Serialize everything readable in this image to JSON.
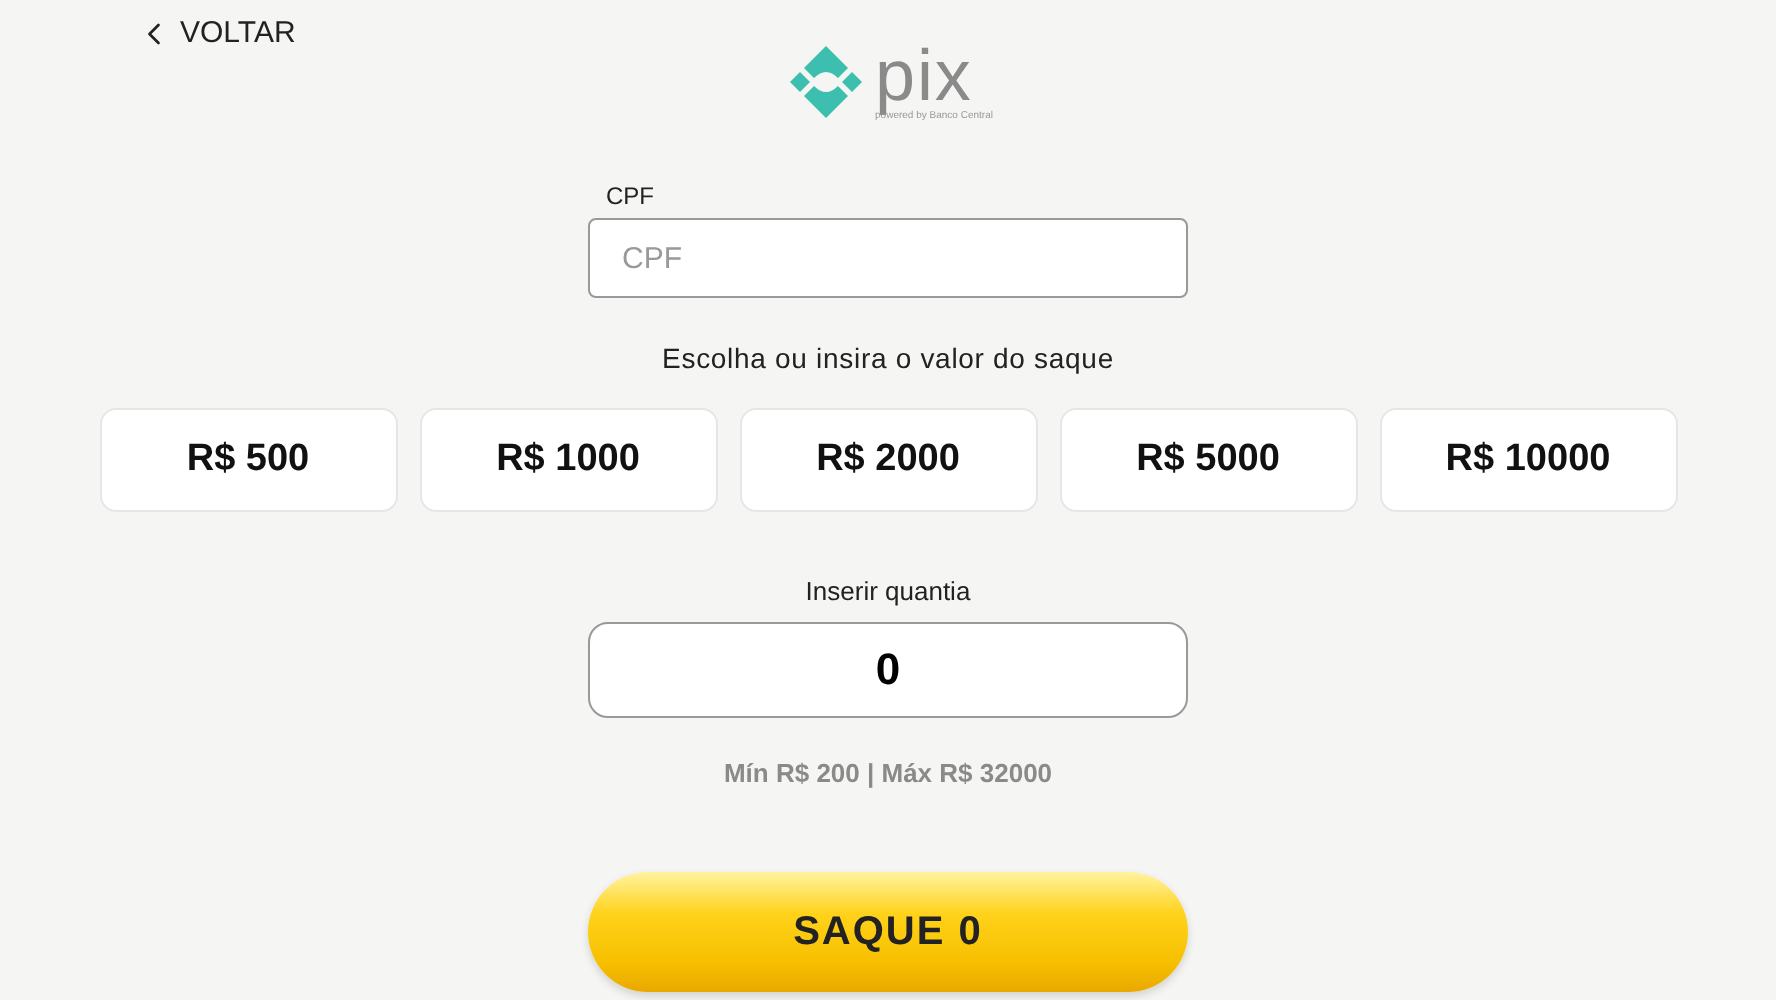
{
  "back_link": {
    "label": "VOLTAR"
  },
  "logo": {
    "wordmark": "pix",
    "tagline": "powered by Banco Central"
  },
  "cpf_field": {
    "label": "CPF",
    "placeholder": "CPF"
  },
  "amount_prompt": "Escolha ou insira o valor do saque",
  "amount_options": [
    {
      "label": "R$ 500",
      "selected": false
    },
    {
      "label": "R$ 1000",
      "selected": false
    },
    {
      "label": "R$ 2000",
      "selected": false
    },
    {
      "label": "R$ 5000",
      "selected": false
    },
    {
      "label": "R$ 10000",
      "selected": false
    }
  ],
  "amount_field": {
    "label": "Inserir quantia",
    "value": "0"
  },
  "limits": "Mín R$ 200 | Máx R$ 32000",
  "submit_button": {
    "label": "SAQUE 0"
  }
}
